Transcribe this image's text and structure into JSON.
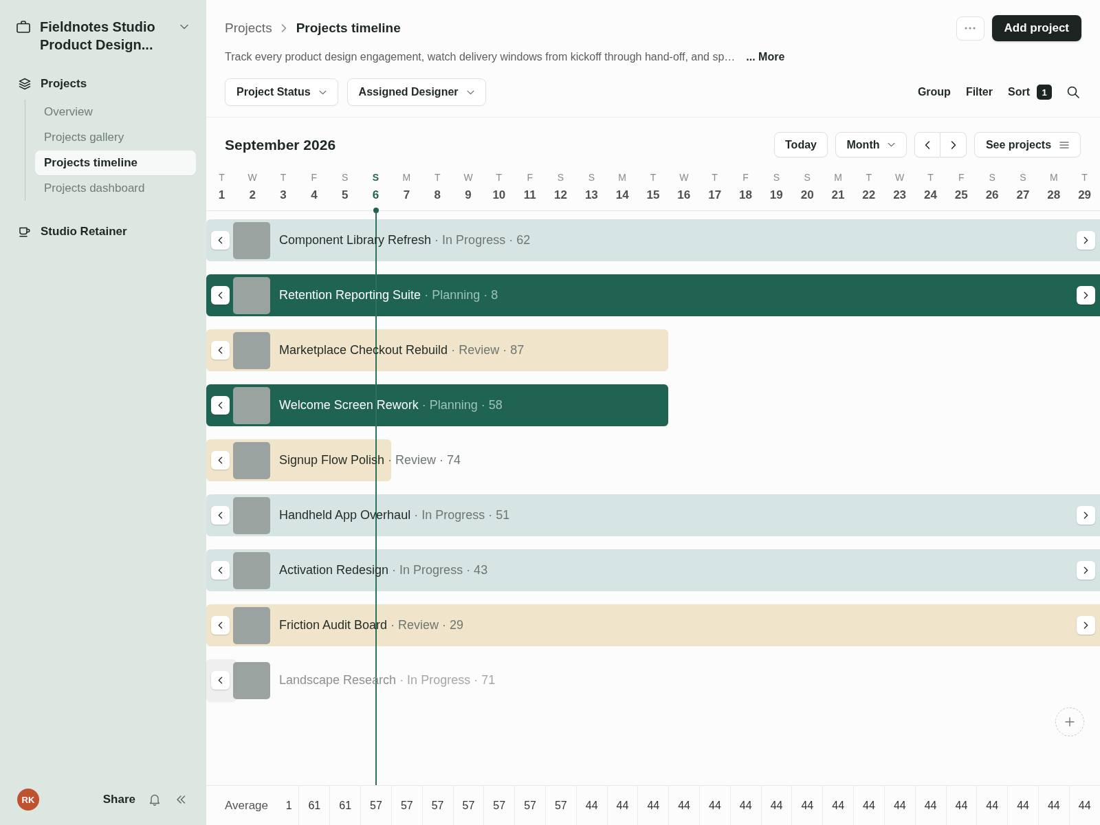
{
  "sidebar": {
    "workspace": "Fieldnotes Studio Product Design...",
    "sections": [
      {
        "label": "Projects",
        "children": [
          {
            "label": "Overview",
            "selected": false
          },
          {
            "label": "Projects gallery",
            "selected": false
          },
          {
            "label": "Projects timeline",
            "selected": true
          },
          {
            "label": "Projects dashboard",
            "selected": false
          }
        ]
      },
      {
        "label": "Studio Retainer"
      }
    ],
    "footer": {
      "initials": "RK",
      "share_label": "Share"
    }
  },
  "header": {
    "breadcrumb": [
      "Projects",
      "Projects timeline"
    ],
    "primary_action": "Add project",
    "description": "Track every product design engagement, watch delivery windows from kickoff through hand-off, and sp…",
    "more_link": "... More",
    "filters": [
      "Project Status",
      "Assigned Designer"
    ],
    "view_actions": [
      {
        "label": "Group"
      },
      {
        "label": "Filter"
      },
      {
        "label": "Sort",
        "badge": "1"
      }
    ]
  },
  "calendar": {
    "title": "September 2026",
    "today_label": "Today",
    "view": "Month",
    "list_label": "See projects",
    "days": [
      {
        "weekday": "T",
        "date": "1",
        "today": false
      },
      {
        "weekday": "W",
        "date": "2",
        "today": false
      },
      {
        "weekday": "T",
        "date": "3",
        "today": false
      },
      {
        "weekday": "F",
        "date": "4",
        "today": false
      },
      {
        "weekday": "S",
        "date": "5",
        "today": false
      },
      {
        "weekday": "S",
        "date": "6",
        "today": true
      },
      {
        "weekday": "M",
        "date": "7",
        "today": false
      },
      {
        "weekday": "T",
        "date": "8",
        "today": false
      },
      {
        "weekday": "W",
        "date": "9",
        "today": false
      },
      {
        "weekday": "T",
        "date": "10",
        "today": false
      },
      {
        "weekday": "F",
        "date": "11",
        "today": false
      },
      {
        "weekday": "S",
        "date": "12",
        "today": false
      },
      {
        "weekday": "S",
        "date": "13",
        "today": false
      },
      {
        "weekday": "M",
        "date": "14",
        "today": false
      },
      {
        "weekday": "T",
        "date": "15",
        "today": false
      },
      {
        "weekday": "W",
        "date": "16",
        "today": false
      },
      {
        "weekday": "T",
        "date": "17",
        "today": false
      },
      {
        "weekday": "F",
        "date": "18",
        "today": false
      },
      {
        "weekday": "S",
        "date": "19",
        "today": false
      },
      {
        "weekday": "S",
        "date": "20",
        "today": false
      },
      {
        "weekday": "M",
        "date": "21",
        "today": false
      },
      {
        "weekday": "T",
        "date": "22",
        "today": false
      },
      {
        "weekday": "W",
        "date": "23",
        "today": false
      },
      {
        "weekday": "T",
        "date": "24",
        "today": false
      },
      {
        "weekday": "F",
        "date": "25",
        "today": false
      },
      {
        "weekday": "S",
        "date": "26",
        "today": false
      },
      {
        "weekday": "S",
        "date": "27",
        "today": false
      },
      {
        "weekday": "M",
        "date": "28",
        "today": false
      },
      {
        "weekday": "T",
        "date": "29",
        "today": false
      }
    ]
  },
  "projects": [
    {
      "title": "Component Library Refresh",
      "details": "· In Progress · 62",
      "color": "#d6e4e3",
      "level": 1,
      "continues": true,
      "dimmed": false
    },
    {
      "title": "Retention Reporting Suite",
      "details": "· Planning · 8",
      "color": "#1f6452",
      "level": 1,
      "continues": true,
      "dimmed": false
    },
    {
      "title": "Marketplace Checkout Rebuild",
      "details": "· Review · 87",
      "color": "#f0e4ca",
      "level": 0.517,
      "continues": false,
      "dimmed": false
    },
    {
      "title": "Welcome Screen Rework",
      "details": "· Planning · 58",
      "color": "#1f6452",
      "level": 0.517,
      "continues": false,
      "dimmed": false
    },
    {
      "title": "Signup Flow Polish",
      "details": "· Review · 74",
      "color": "#f0e4ca",
      "level": 0.207,
      "continues": false,
      "dimmed": false
    },
    {
      "title": "Handheld App Overhaul",
      "details": "· In Progress · 51",
      "color": "#d6e4e3",
      "level": 1,
      "continues": true,
      "dimmed": false
    },
    {
      "title": "Activation Redesign",
      "details": "· In Progress · 43",
      "color": "#d6e4e3",
      "level": 1,
      "continues": true,
      "dimmed": false
    },
    {
      "title": "Friction Audit Board",
      "details": "· Review · 29",
      "color": "#f0e4ca",
      "level": 1,
      "continues": true,
      "dimmed": false
    },
    {
      "title": "Landscape Research",
      "details": "· In Progress · 71",
      "color": "#efefef",
      "level": 0.034,
      "continues": false,
      "dimmed": true
    }
  ],
  "summary": {
    "label": "Average",
    "clipped_value": "1",
    "values": [
      "61",
      "61",
      "57",
      "57",
      "57",
      "57",
      "57",
      "57",
      "57",
      "44",
      "44",
      "44",
      "44",
      "44",
      "44",
      "44",
      "44",
      "44",
      "44",
      "44",
      "44",
      "44",
      "44",
      "44",
      "44",
      "44"
    ]
  }
}
